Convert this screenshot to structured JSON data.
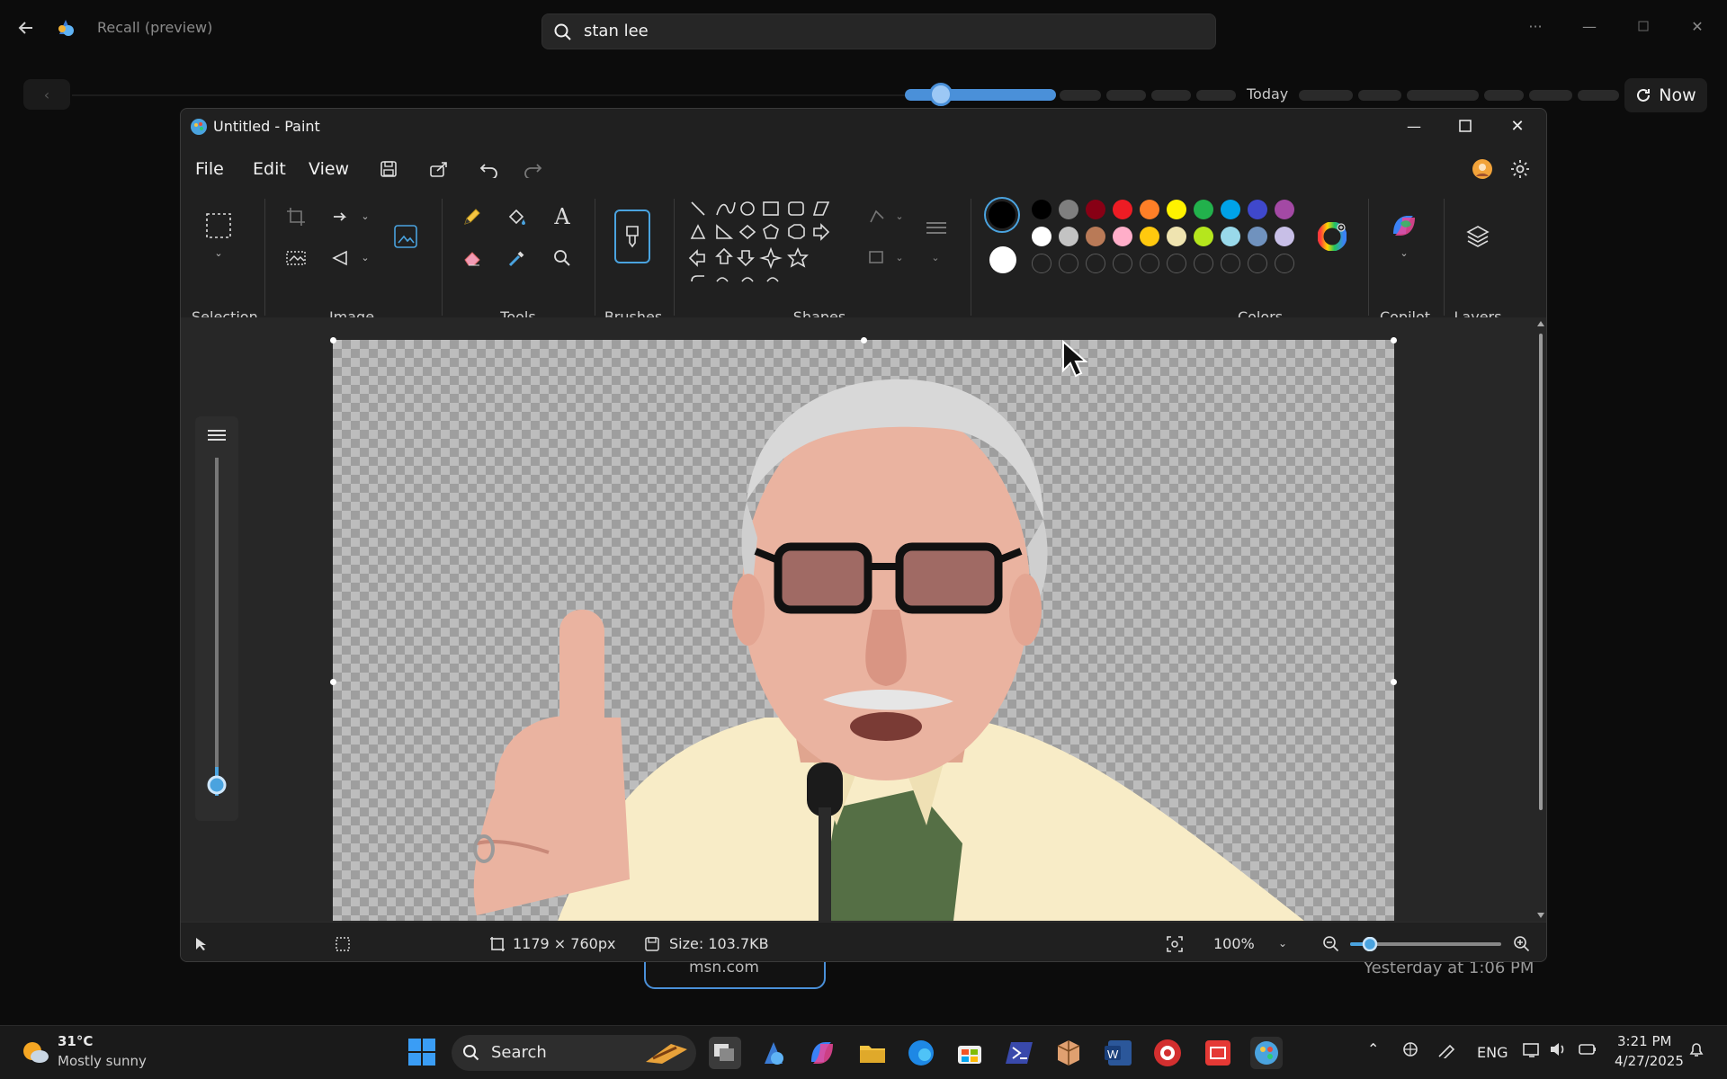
{
  "recall": {
    "title": "Recall (preview)",
    "search_query": "stan lee",
    "timeline_today": "Today",
    "now_label": "Now"
  },
  "paint": {
    "window_title": "Untitled - Paint",
    "menu": [
      "File",
      "Edit",
      "View"
    ],
    "groups": {
      "selection": "Selection",
      "image": "Image",
      "tools": "Tools",
      "brushes": "Brushes",
      "shapes": "Shapes",
      "colors": "Colors",
      "copilot": "Copilot",
      "layers": "Layers"
    },
    "colors": {
      "primary": "#000000",
      "secondary": "#ffffff",
      "row1": [
        "#000000",
        "#7f7f7f",
        "#880015",
        "#ed1c24",
        "#ff7f27",
        "#fff200",
        "#22b14c",
        "#00a2e8",
        "#3f48cc",
        "#a349a4"
      ],
      "row2": [
        "#ffffff",
        "#c3c3c3",
        "#b97a57",
        "#ffaec9",
        "#ffc90e",
        "#efe4b0",
        "#b5e61d",
        "#99d9ea",
        "#7092be",
        "#c8bfe7"
      ]
    },
    "status": {
      "dimensions": "1179 × 760px",
      "size": "Size: 103.7KB",
      "zoom": "100%"
    }
  },
  "behind": {
    "source": "msn.com",
    "timestamp": "Yesterday at 1:06 PM"
  },
  "taskbar": {
    "weather_temp": "31°C",
    "weather_desc": "Mostly sunny",
    "search_label": "Search",
    "language": "ENG",
    "time": "3:21 PM",
    "date": "4/27/2025"
  }
}
